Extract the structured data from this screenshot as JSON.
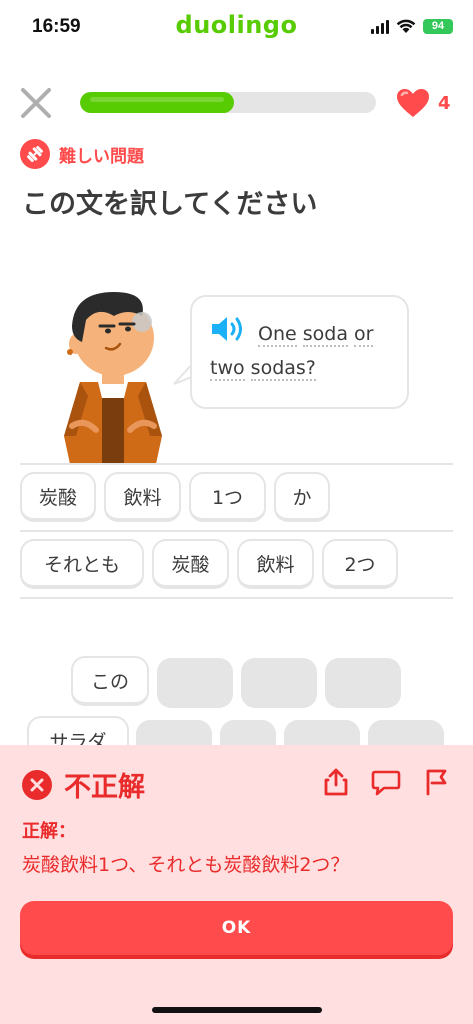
{
  "status_bar": {
    "time": "16:59",
    "brand": "duolingo",
    "battery": "94"
  },
  "top_bar": {
    "progress": 0.52,
    "hearts": "4"
  },
  "challenge": {
    "tag_label": "難しい問題",
    "title": "この文を訳してください",
    "speech_line1": [
      "One",
      "soda",
      "or"
    ],
    "speech_line2": [
      "two",
      "sodas?"
    ]
  },
  "word_bank": {
    "row1": [
      "炭酸",
      "飲料",
      "1つ",
      "か"
    ],
    "row2": [
      "それとも",
      "炭酸",
      "飲料",
      "2つ"
    ]
  },
  "answer_area": {
    "row1_word": "この",
    "row2_word": "サラダ"
  },
  "feedback": {
    "title": "不正解",
    "correct_label": "正解：",
    "correct_answer": "炭酸飲料1つ、それとも炭酸飲料2つ？",
    "button_label": "OK"
  },
  "colors": {
    "accent_green": "#58cc02",
    "error_red": "#ea2b2b",
    "button_red": "#ff4b4b",
    "feedback_bg": "#ffdfe0"
  }
}
